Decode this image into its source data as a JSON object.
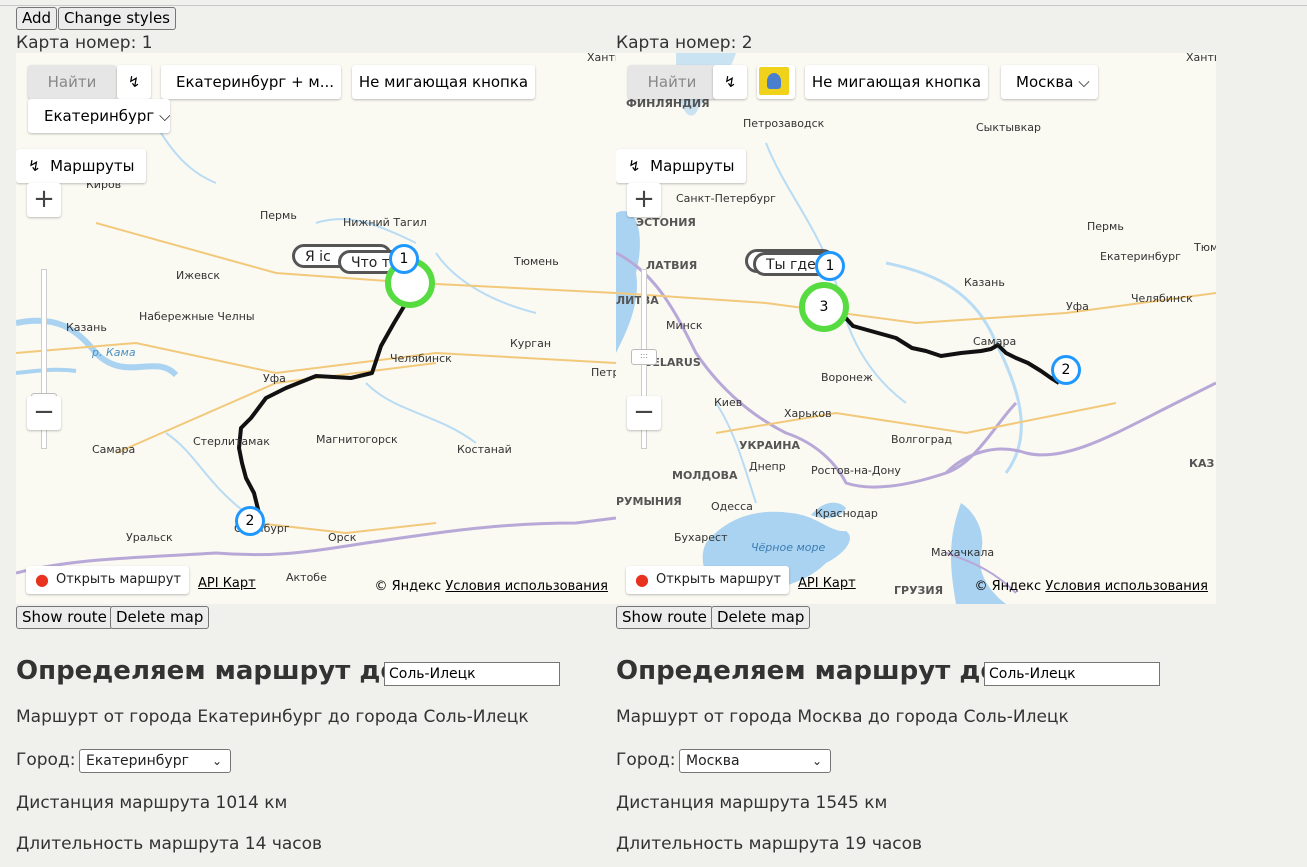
{
  "toolbar": {
    "add_label": "Add",
    "change_styles_label": "Change styles"
  },
  "maps": [
    {
      "heading": "Карта номер: 1",
      "find_label": "Найти",
      "route_button_label": "Екатеринбург + м...",
      "blink_button_label": "Не мигающая кнопка",
      "city_dropdown_label": "Екатеринбург",
      "routes_label": "Маршруты",
      "open_route_label": "Открыть маршрут",
      "api_label": "API Карт",
      "copyright": "© Яндекс",
      "terms_label": "Условия использования",
      "balloon_labels": [
        "Я іс",
        "Что т"
      ],
      "pin_labels": [
        "1",
        "2"
      ],
      "city_labels": [
        "Киров",
        "Пермь",
        "Нижний Тагил",
        "Ханты",
        "Тюмень",
        "Ижевск",
        "Набережные Челны",
        "Казань",
        "р. Кама",
        "Челябинск",
        "Курган",
        "Петр",
        "Уфа",
        "Самара",
        "Стерлитамак",
        "Магнитогорск",
        "Костанай",
        "Оренбург",
        "Уральск",
        "Орск",
        "Актобе"
      ],
      "show_route_label": "Show route",
      "delete_map_label": "Delete map",
      "route_heading": "Определяем маршрут до:",
      "destination_value": "Соль-Илецк",
      "route_description": "Маршурт от города Екатеринбург до города Соль-Илецк",
      "city_field_label": "Город:",
      "city_select_value": "Екатеринбург",
      "distance_text": "Дистанция маршрута 1014 км",
      "duration_text": "Длительность маршрута 14 часов"
    },
    {
      "heading": "Карта номер: 2",
      "find_label": "Найти",
      "blink_button_label": "Не мигающая кнопка",
      "city_dropdown_label": "Москва",
      "routes_label": "Маршруты",
      "open_route_label": "Открыть маршрут",
      "api_label": "API Карт",
      "copyright": "© Яндекс",
      "terms_label": "Условия использования",
      "balloon_labels": [
        "Ты где"
      ],
      "pin_labels": [
        "1",
        "2"
      ],
      "cluster_label": "3",
      "city_labels": [
        "Ханты",
        "ФИНЛЯНДИЯ",
        "Петрозаводск",
        "Сыктывкар",
        "Санкт-Петербург",
        "ЭСТОНИЯ",
        "Пермь",
        "Тюме",
        "ЛАТВИЯ",
        "Екатеринбург",
        "ЛИТВА",
        "Казань",
        "Уфа",
        "Челябинск",
        "Минск",
        "Самара",
        "BELARUS",
        "Воронеж",
        "Киев",
        "Харьков",
        "УКРАИНА",
        "Волгоград",
        "Днепр",
        "Ростов-на-Дону",
        "МОЛДОВА",
        "КАЗ",
        "РУМЫНИЯ",
        "Одесса",
        "Краснодар",
        "Бухарест",
        "Чёрное море",
        "Махачкала",
        "ГРУЗИЯ"
      ],
      "show_route_label": "Show route",
      "delete_map_label": "Delete map",
      "route_heading": "Определяем маршрут до:",
      "destination_value": "Соль-Илецк",
      "route_description": "Маршурт от города Москва до города Соль-Илецк",
      "city_field_label": "Город:",
      "city_select_value": "Москва",
      "distance_text": "Дистанция маршрута 1545 км",
      "duration_text": "Длительность маршрута 19 часов"
    }
  ],
  "colors": {
    "route": "#111111",
    "pin": "#1e98ff",
    "cluster": "#56db40",
    "water": "#aad3f2",
    "border": "#b8a8d8",
    "road": "#f2c97a"
  },
  "icons": [
    "route-icon",
    "chevron-down-icon",
    "plus-icon",
    "minus-icon",
    "location-pin-icon",
    "picture-icon"
  ]
}
